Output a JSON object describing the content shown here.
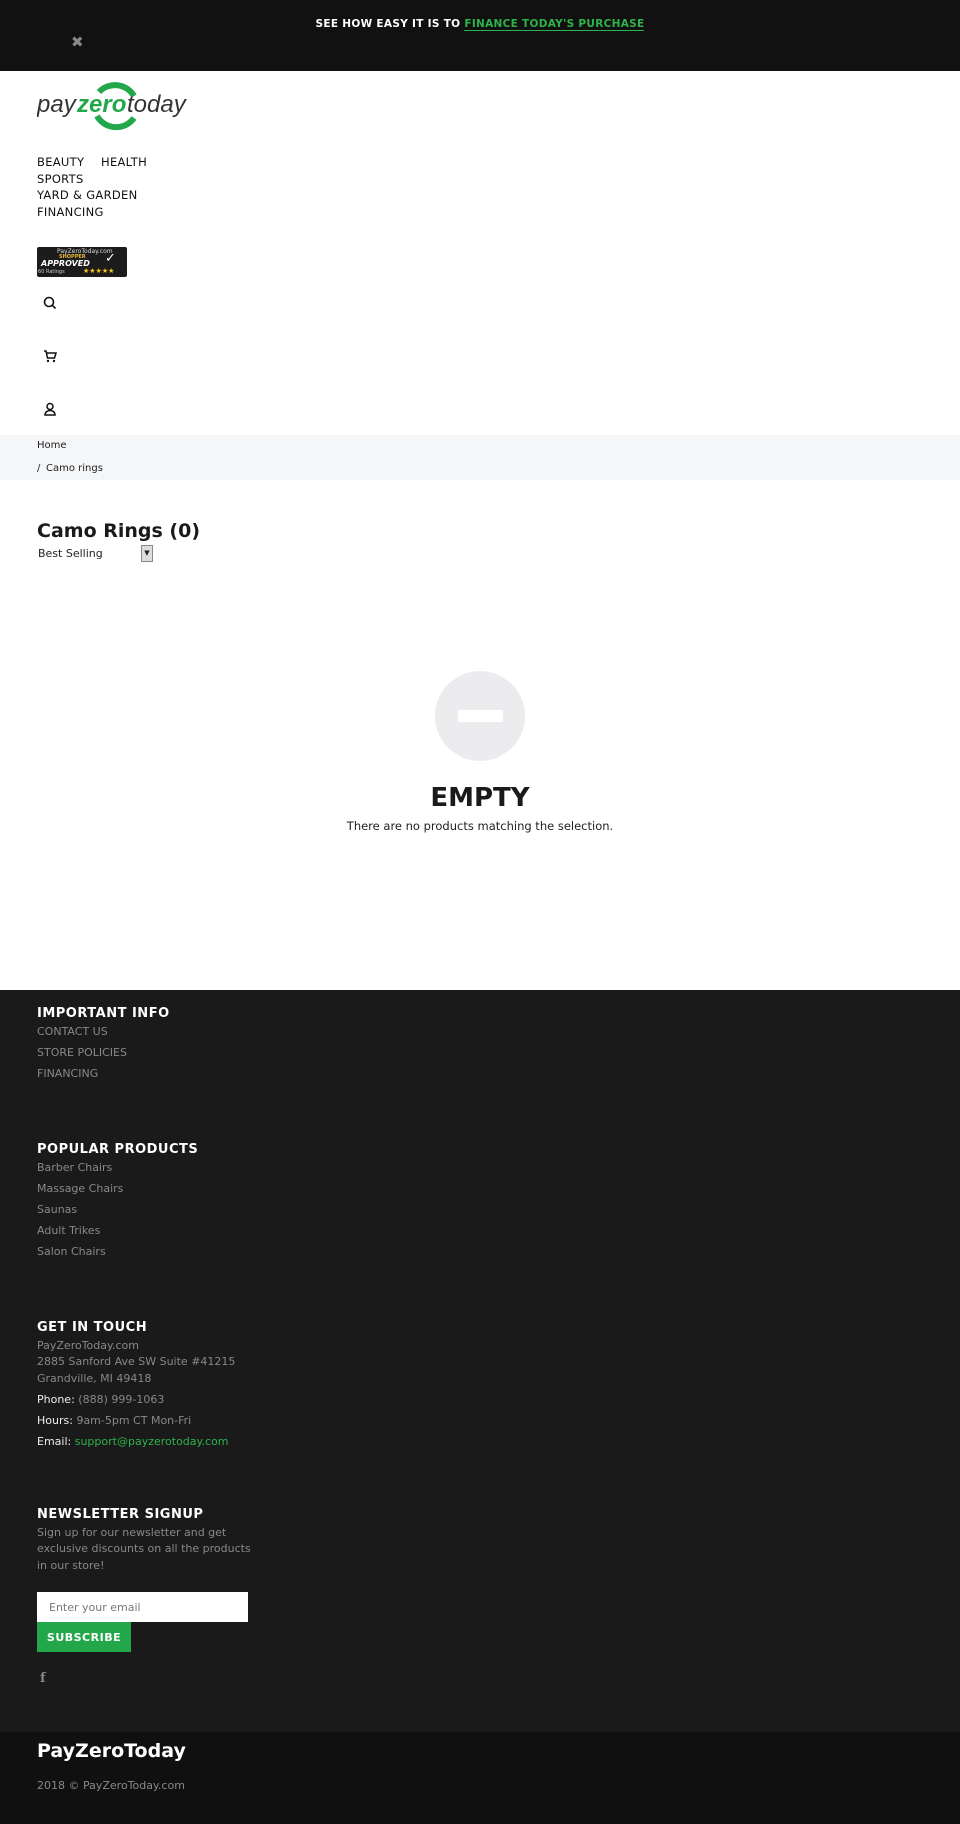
{
  "banner": {
    "text": "SEE HOW EASY IT IS TO ",
    "link": "FINANCE TODAY'S PURCHASE",
    "close_icon": "close-icon"
  },
  "logo": {
    "text_pay": "pay",
    "text_zero": "zero",
    "text_today": "today"
  },
  "nav": [
    {
      "label": "BEAUTY"
    },
    {
      "label": "HEALTH"
    },
    {
      "label": "SPORTS"
    },
    {
      "label": "YARD & GARDEN"
    },
    {
      "label": "FINANCING"
    }
  ],
  "badge": {
    "site": "PayZeroToday.com",
    "line1": "SHOPPER",
    "line2": "APPROVED",
    "ratings": "60 Ratings",
    "stars": "★★★★★"
  },
  "icons": {
    "search": "search-icon",
    "cart": "cart-icon",
    "account": "user-icon"
  },
  "breadcrumb": {
    "home": "Home",
    "separator": "/",
    "current": "Camo rings"
  },
  "collection": {
    "title": "Camo Rings (0)",
    "sort_selected": "Best Selling"
  },
  "empty": {
    "title": "EMPTY",
    "description": "There are no products matching the selection."
  },
  "footer": {
    "important": {
      "heading": "IMPORTANT INFO",
      "links": [
        "CONTACT US",
        "STORE POLICIES",
        "FINANCING"
      ]
    },
    "popular": {
      "heading": "POPULAR PRODUCTS",
      "links": [
        "Barber Chairs",
        "Massage Chairs",
        "Saunas",
        "Adult Trikes",
        "Salon Chairs"
      ]
    },
    "contact": {
      "heading": "GET IN TOUCH",
      "address": [
        "PayZeroToday.com",
        "2885 Sanford Ave SW Suite #41215",
        "Grandville, MI 49418"
      ],
      "phone_label": "Phone:",
      "phone": "(888) 999-1063",
      "hours_label": "Hours:",
      "hours": "9am-5pm CT Mon-Fri",
      "email_label": "Email:",
      "email": "support@payzerotoday.com"
    },
    "newsletter": {
      "heading": "NEWSLETTER SIGNUP",
      "lines": [
        "Sign up for our newsletter and get",
        "exclusive discounts on all the products",
        "in our store!"
      ],
      "placeholder": "Enter your email",
      "button": "SUBSCRIBE"
    },
    "social": {
      "facebook": "f"
    },
    "brand": "PayZeroToday",
    "copyright": "2018 © PayZeroToday.com"
  },
  "colors": {
    "accent": "#2db34a",
    "banner_bg": "#111111",
    "footer_bg": "#1a1a1a",
    "bottom_bg": "#101010",
    "button": "#22a84a"
  }
}
